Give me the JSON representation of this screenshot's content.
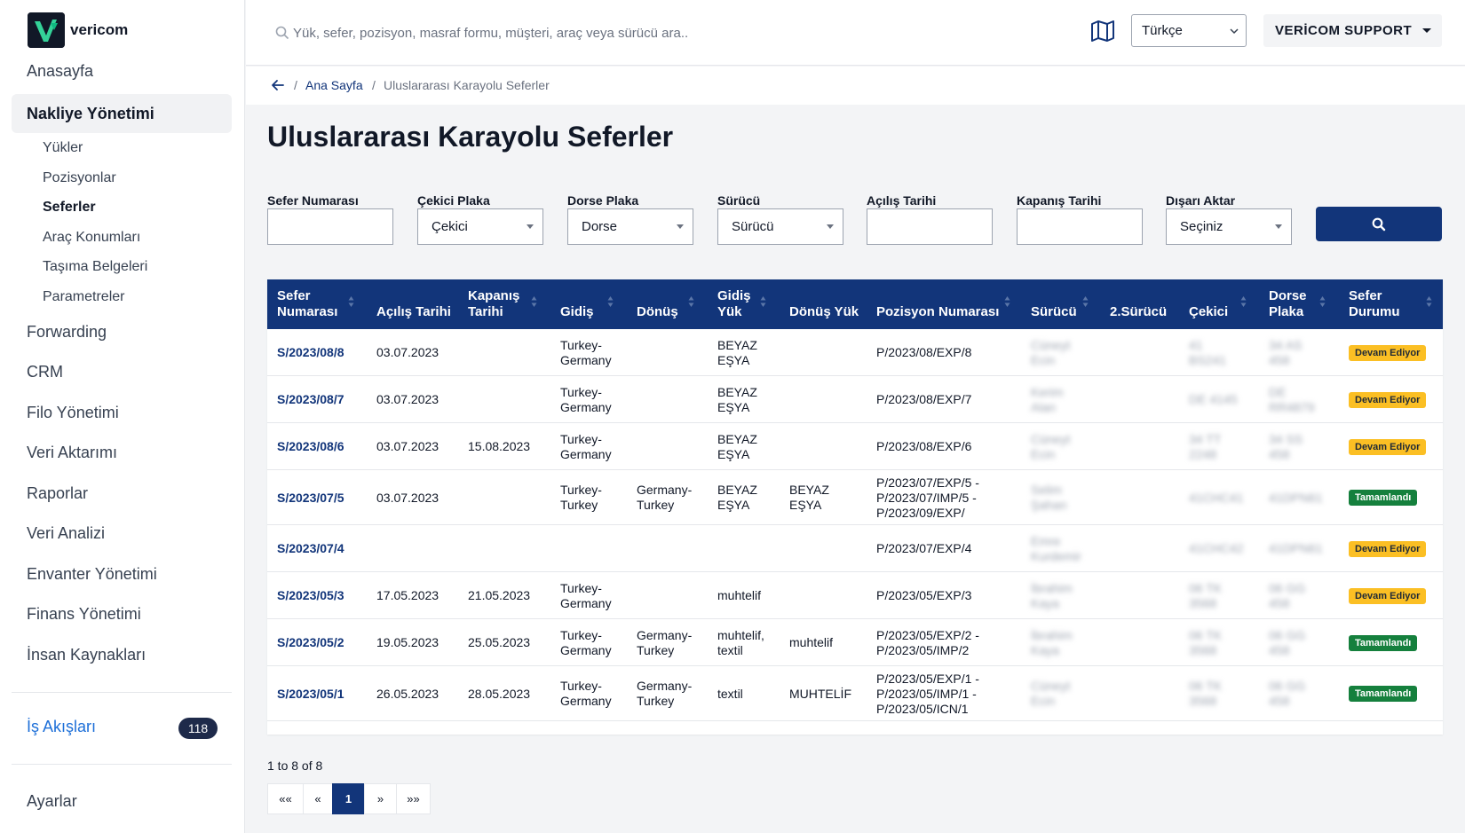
{
  "brand": {
    "name": "vericom"
  },
  "sidebar": {
    "items": [
      {
        "label": "Anasayfa"
      },
      {
        "label": "Nakliye Yönetimi"
      },
      {
        "label": "Forwarding"
      },
      {
        "label": "CRM"
      },
      {
        "label": "Filo Yönetimi"
      },
      {
        "label": "Veri Aktarımı"
      },
      {
        "label": "Raporlar"
      },
      {
        "label": "Veri Analizi"
      },
      {
        "label": "Envanter Yönetimi"
      },
      {
        "label": "Finans Yönetimi"
      },
      {
        "label": "İnsan Kaynakları"
      }
    ],
    "subitems": [
      {
        "label": "Yükler"
      },
      {
        "label": "Pozisyonlar"
      },
      {
        "label": "Seferler"
      },
      {
        "label": "Araç Konumları"
      },
      {
        "label": "Taşıma Belgeleri"
      },
      {
        "label": "Parametreler"
      }
    ],
    "workflow_label": "İş Akışları",
    "workflow_count": "118",
    "settings_label": "Ayarlar"
  },
  "header": {
    "search_placeholder": "Yük, sefer, pozisyon, masraf formu, müşteri, araç veya sürücü ara..",
    "language": "Türkçe",
    "user": "VERİCOM SUPPORT",
    "map_icon": "map-icon"
  },
  "breadcrumb": {
    "home": "Ana Sayfa",
    "current": "Uluslararası Karayolu Seferler",
    "sep": "/"
  },
  "page": {
    "title": "Uluslararası Karayolu Seferler"
  },
  "filters": [
    {
      "label": "Sefer Numarası",
      "value": ""
    },
    {
      "label": "Çekici Plaka",
      "value": "Çekici"
    },
    {
      "label": "Dorse Plaka",
      "value": "Dorse"
    },
    {
      "label": "Sürücü",
      "value": "Sürücü"
    },
    {
      "label": "Açılış Tarihi",
      "value": ""
    },
    {
      "label": "Kapanış Tarihi",
      "value": ""
    },
    {
      "label": "Dışarı Aktar",
      "value": "Seçiniz"
    }
  ],
  "table": {
    "headers": {
      "sefer1": "Sefer",
      "sefer2": "Numarası",
      "acilis": "Açılış Tarihi",
      "kapanis1": "Kapanış",
      "kapanis2": "Tarihi",
      "gidis": "Gidiş",
      "donus": "Dönüş",
      "gidisyuk1": "Gidiş",
      "gidisyuk2": "Yük",
      "donusyuk": "Dönüş Yük",
      "pozisyon": "Pozisyon Numarası",
      "surucu": "Sürücü",
      "surucu2": "2.Sürücü",
      "cekici": "Çekici",
      "dorse1": "Dorse",
      "dorse2": "Plaka",
      "durum1": "Sefer",
      "durum2": "Durumu"
    },
    "rows": [
      {
        "no": "S/2023/08/8",
        "acilis": "03.07.2023",
        "kapanis": "",
        "gidis1": "Turkey-",
        "gidis2": "Germany",
        "donus1": "",
        "donus2": "",
        "gyuk1": "BEYAZ",
        "gyuk2": "EŞYA",
        "dyuk1": "",
        "dyuk2": "",
        "poz": [
          "P/2023/08/EXP/8"
        ],
        "surucu1": "Cüneyt",
        "surucu2": "Ecin",
        "cekici1": "41",
        "cekici2": "BS241",
        "dorse1": "34 AS",
        "dorse2": "458",
        "status": "Devam Ediyor"
      },
      {
        "no": "S/2023/08/7",
        "acilis": "03.07.2023",
        "kapanis": "",
        "gidis1": "Turkey-",
        "gidis2": "Germany",
        "donus1": "",
        "donus2": "",
        "gyuk1": "BEYAZ",
        "gyuk2": "EŞYA",
        "dyuk1": "",
        "dyuk2": "",
        "poz": [
          "P/2023/08/EXP/7"
        ],
        "surucu1": "Kerim",
        "surucu2": "Alan",
        "cekici1": "DE 4145",
        "cekici2": "",
        "dorse1": "DE",
        "dorse2": "RR4879",
        "status": "Devam Ediyor"
      },
      {
        "no": "S/2023/08/6",
        "acilis": "03.07.2023",
        "kapanis": "15.08.2023",
        "gidis1": "Turkey-",
        "gidis2": "Germany",
        "donus1": "",
        "donus2": "",
        "gyuk1": "BEYAZ",
        "gyuk2": "EŞYA",
        "dyuk1": "",
        "dyuk2": "",
        "poz": [
          "P/2023/08/EXP/6"
        ],
        "surucu1": "Cüneyt",
        "surucu2": "Ecin",
        "cekici1": "34 TT",
        "cekici2": "2248",
        "dorse1": "34 SS",
        "dorse2": "458",
        "status": "Devam Ediyor"
      },
      {
        "no": "S/2023/07/5",
        "acilis": "03.07.2023",
        "kapanis": "",
        "gidis1": "Turkey-",
        "gidis2": "Turkey",
        "donus1": "Germany-",
        "donus2": "Turkey",
        "gyuk1": "BEYAZ",
        "gyuk2": "EŞYA",
        "dyuk1": "BEYAZ",
        "dyuk2": "EŞYA",
        "poz": [
          "P/2023/07/EXP/5 -",
          "P/2023/07/IMP/5 -",
          "P/2023/09/EXP/"
        ],
        "surucu1": "Selim",
        "surucu2": "Şahan",
        "cekici1": "41CHC41",
        "cekici2": "",
        "dorse1": "41DPN61",
        "dorse2": "",
        "status": "Tamamlandı"
      },
      {
        "no": "S/2023/07/4",
        "acilis": "",
        "kapanis": "",
        "gidis1": "",
        "gidis2": "",
        "donus1": "",
        "donus2": "",
        "gyuk1": "",
        "gyuk2": "",
        "dyuk1": "",
        "dyuk2": "",
        "poz": [
          "P/2023/07/EXP/4"
        ],
        "surucu1": "Emre",
        "surucu2": "Kurdemir",
        "cekici1": "41CHC42",
        "cekici2": "",
        "dorse1": "41DPN61",
        "dorse2": "",
        "status": "Devam Ediyor"
      },
      {
        "no": "S/2023/05/3",
        "acilis": "17.05.2023",
        "kapanis": "21.05.2023",
        "gidis1": "Turkey-",
        "gidis2": "Germany",
        "donus1": "",
        "donus2": "",
        "gyuk1": "muhtelif",
        "gyuk2": "",
        "dyuk1": "",
        "dyuk2": "",
        "poz": [
          "P/2023/05/EXP/3"
        ],
        "surucu1": "İbrahim",
        "surucu2": "Kaya",
        "cekici1": "06 TK",
        "cekici2": "3568",
        "dorse1": "06 GG",
        "dorse2": "458",
        "status": "Devam Ediyor"
      },
      {
        "no": "S/2023/05/2",
        "acilis": "19.05.2023",
        "kapanis": "25.05.2023",
        "gidis1": "Turkey-",
        "gidis2": "Germany",
        "donus1": "Germany-",
        "donus2": "Turkey",
        "gyuk1": "muhtelif,",
        "gyuk2": "textil",
        "dyuk1": "muhtelif",
        "dyuk2": "",
        "poz": [
          "P/2023/05/EXP/2 -",
          "P/2023/05/IMP/2"
        ],
        "surucu1": "İbrahim",
        "surucu2": "Kaya",
        "cekici1": "06 TK",
        "cekici2": "3568",
        "dorse1": "06 GG",
        "dorse2": "458",
        "status": "Tamamlandı"
      },
      {
        "no": "S/2023/05/1",
        "acilis": "26.05.2023",
        "kapanis": "28.05.2023",
        "gidis1": "Turkey-",
        "gidis2": "Germany",
        "donus1": "Germany-",
        "donus2": "Turkey",
        "gyuk1": "textil",
        "gyuk2": "",
        "dyuk1": "MUHTELİF",
        "dyuk2": "",
        "poz": [
          "P/2023/05/EXP/1 -",
          "P/2023/05/IMP/1 -",
          "P/2023/05/ICN/1"
        ],
        "surucu1": "Cüneyt",
        "surucu2": "Ecin",
        "cekici1": "06 TK",
        "cekici2": "3568",
        "dorse1": "06 GG",
        "dorse2": "458",
        "status": "Tamamlandı"
      }
    ]
  },
  "pagination": {
    "range": "1 to 8 of 8",
    "first": "««",
    "prev": "«",
    "current": "1",
    "next": "»",
    "last": "»»"
  },
  "colors": {
    "primary": "#12357a",
    "link": "#1d6fd8",
    "warning": "#fbbf24",
    "success": "#15803d"
  }
}
